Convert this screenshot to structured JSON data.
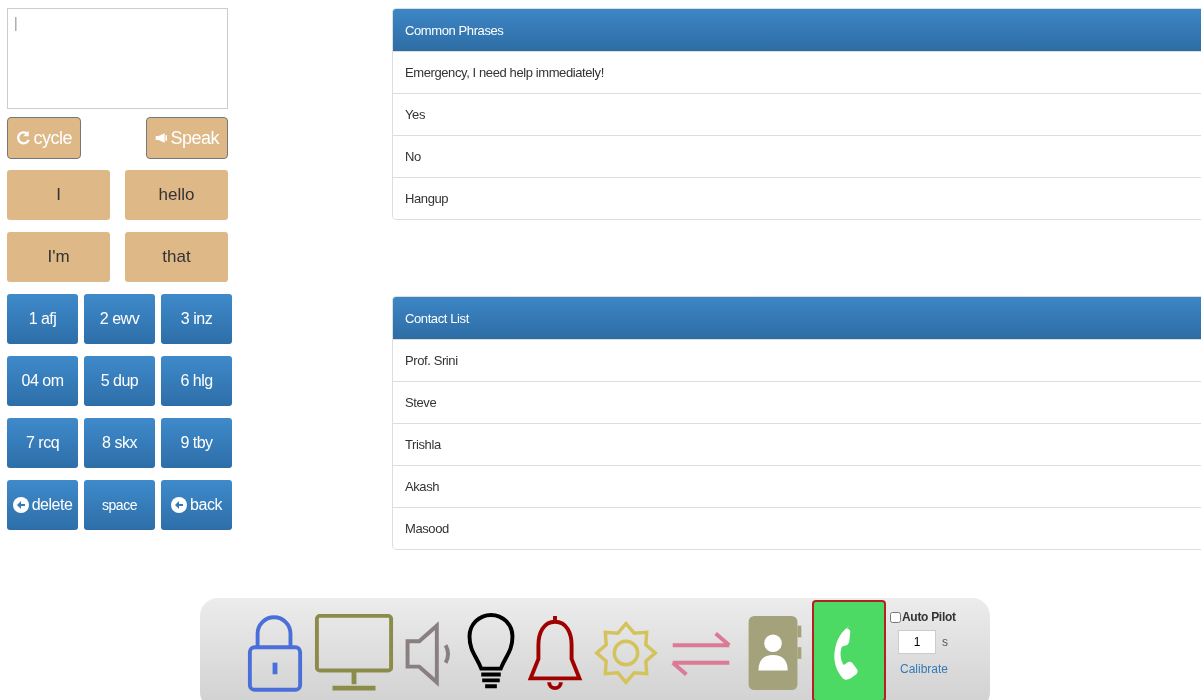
{
  "composer": {
    "placeholder": "|"
  },
  "actions": [
    {
      "kind": "cycle",
      "label": "cycle"
    },
    {
      "kind": "speak",
      "label": "Speak"
    }
  ],
  "suggestions": [
    "I",
    "hello",
    "I'm",
    "that"
  ],
  "keypad": [
    {
      "kind": "key",
      "label": "1 afj"
    },
    {
      "kind": "key",
      "label": "2 ewv"
    },
    {
      "kind": "key",
      "label": "3 inz"
    },
    {
      "kind": "key",
      "label": "04 om"
    },
    {
      "kind": "key",
      "label": "5 dup"
    },
    {
      "kind": "key",
      "label": "6 hlg"
    },
    {
      "kind": "key",
      "label": "7 rcq"
    },
    {
      "kind": "key",
      "label": "8 skx"
    },
    {
      "kind": "key",
      "label": "9 tby"
    },
    {
      "kind": "delete",
      "label": "delete"
    },
    {
      "kind": "key",
      "label": "space"
    },
    {
      "kind": "back",
      "label": "back"
    }
  ],
  "panels": [
    {
      "title": "Common Phrases",
      "items": [
        "Emergency, I need help immediately!",
        "Yes",
        "No",
        "Hangup"
      ]
    },
    {
      "title": "Contact List",
      "items": [
        "Prof. Srini",
        "Steve",
        "Trishla",
        "Akash",
        "Masood"
      ]
    }
  ],
  "toolbar": {
    "tools": [
      {
        "kind": "lock",
        "color": "#4a6fd8",
        "selected": false
      },
      {
        "kind": "monitor",
        "color": "#8c8c4a",
        "selected": false
      },
      {
        "kind": "speaker",
        "color": "#8a7f80",
        "selected": false
      },
      {
        "kind": "bulb",
        "color": "#000000",
        "selected": false
      },
      {
        "kind": "bell",
        "color": "#a00000",
        "selected": false
      },
      {
        "kind": "gear",
        "color": "#d4c25a",
        "selected": false
      },
      {
        "kind": "arrows",
        "color": "#dc7a96",
        "selected": false
      },
      {
        "kind": "contacts",
        "color": "#a3a27a",
        "selected": false
      },
      {
        "kind": "phone",
        "color": "#4cd964",
        "selected": true
      }
    ],
    "auto_pilot": {
      "label": "Auto Pilot",
      "checked": false
    },
    "interval": {
      "value": "1",
      "unit": "s"
    },
    "calibrate": "Calibrate"
  }
}
